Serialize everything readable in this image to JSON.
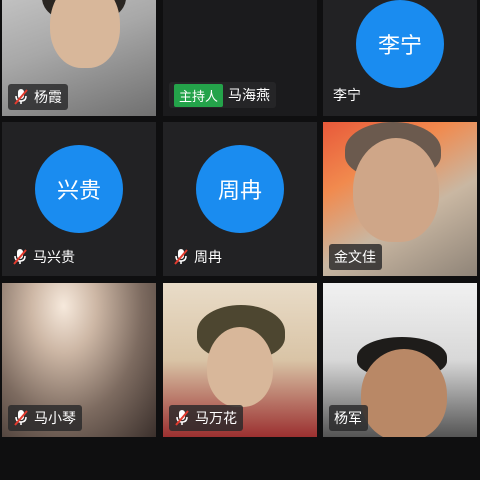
{
  "participants": [
    {
      "name": "杨霞",
      "muted": true,
      "video": true
    },
    {
      "name": "马海燕",
      "host_tag": "主持人",
      "muted": false,
      "video": false
    },
    {
      "name": "李宁",
      "avatar_text": "李宁",
      "muted": false,
      "video": false
    },
    {
      "name": "马兴贵",
      "avatar_text": "兴贵",
      "muted": true,
      "video": false
    },
    {
      "name": "周冉",
      "avatar_text": "周冉",
      "muted": true,
      "video": false
    },
    {
      "name": "金文佳",
      "muted": false,
      "video": true
    },
    {
      "name": "马小琴",
      "muted": true,
      "video": true
    },
    {
      "name": "马万花",
      "muted": true,
      "video": true
    },
    {
      "name": "杨军",
      "muted": false,
      "video": true
    }
  ],
  "colors": {
    "avatar_blue": "#1a8cf0",
    "host_green": "#24a34a",
    "tile_bg": "#222224",
    "mic_muted_red": "#e33b2e"
  }
}
